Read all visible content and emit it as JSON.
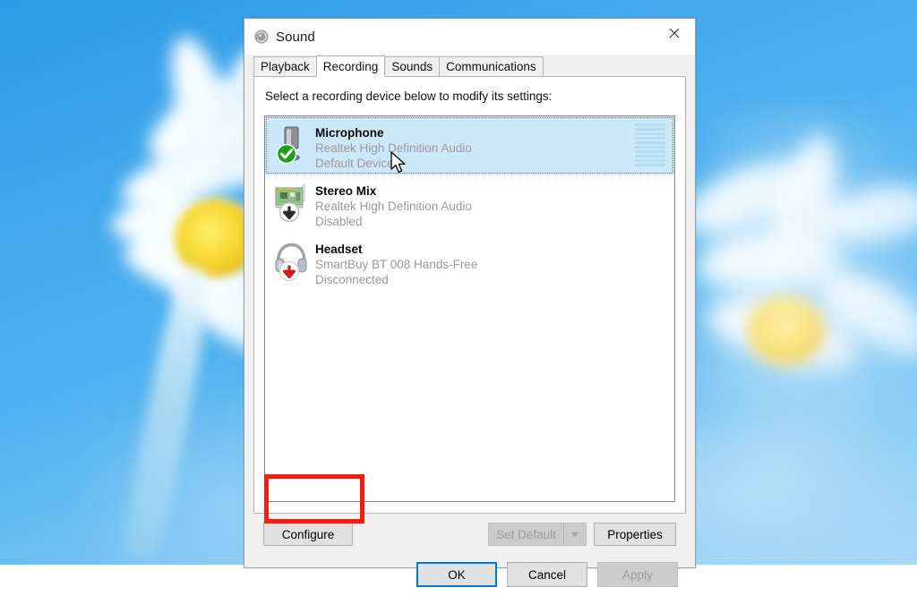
{
  "window": {
    "title": "Sound",
    "icon": "speaker-icon",
    "close_label": "✕"
  },
  "tabs": [
    {
      "label": "Playback",
      "active": false
    },
    {
      "label": "Recording",
      "active": true
    },
    {
      "label": "Sounds",
      "active": false
    },
    {
      "label": "Communications",
      "active": false
    }
  ],
  "panel": {
    "instruction": "Select a recording device below to modify its settings:"
  },
  "devices": [
    {
      "name": "Microphone",
      "description": "Realtek High Definition Audio",
      "status": "Default Device",
      "icon": "microphone-icon",
      "badge": "green-check-badge",
      "selected": true,
      "has_meter": true,
      "meter_segments": 10,
      "meter_active": 0
    },
    {
      "name": "Stereo Mix",
      "description": "Realtek High Definition Audio",
      "status": "Disabled",
      "icon": "sound-card-icon",
      "badge": "black-down-arrow-badge",
      "selected": false,
      "has_meter": false
    },
    {
      "name": "Headset",
      "description": "SmartBuy BT 008 Hands-Free",
      "status": "Disconnected",
      "icon": "headset-icon",
      "badge": "red-down-arrow-badge",
      "selected": false,
      "has_meter": false
    }
  ],
  "buttons": {
    "configure": {
      "label": "Configure",
      "disabled": false
    },
    "set_default": {
      "label": "Set Default",
      "disabled": true,
      "has_dropdown": true
    },
    "properties": {
      "label": "Properties",
      "disabled": false
    },
    "ok": {
      "label": "OK",
      "disabled": false,
      "focused": true
    },
    "cancel": {
      "label": "Cancel",
      "disabled": false
    },
    "apply": {
      "label": "Apply",
      "disabled": true
    }
  },
  "annotation": {
    "target": "configure",
    "color": "#f81b11"
  },
  "colors": {
    "selection": "#cce8f9",
    "accent": "#0078d7",
    "dialog_bg": "#f0f0f0",
    "meter_inactive": "#aedcf0",
    "annotation_red": "#f81b11"
  }
}
